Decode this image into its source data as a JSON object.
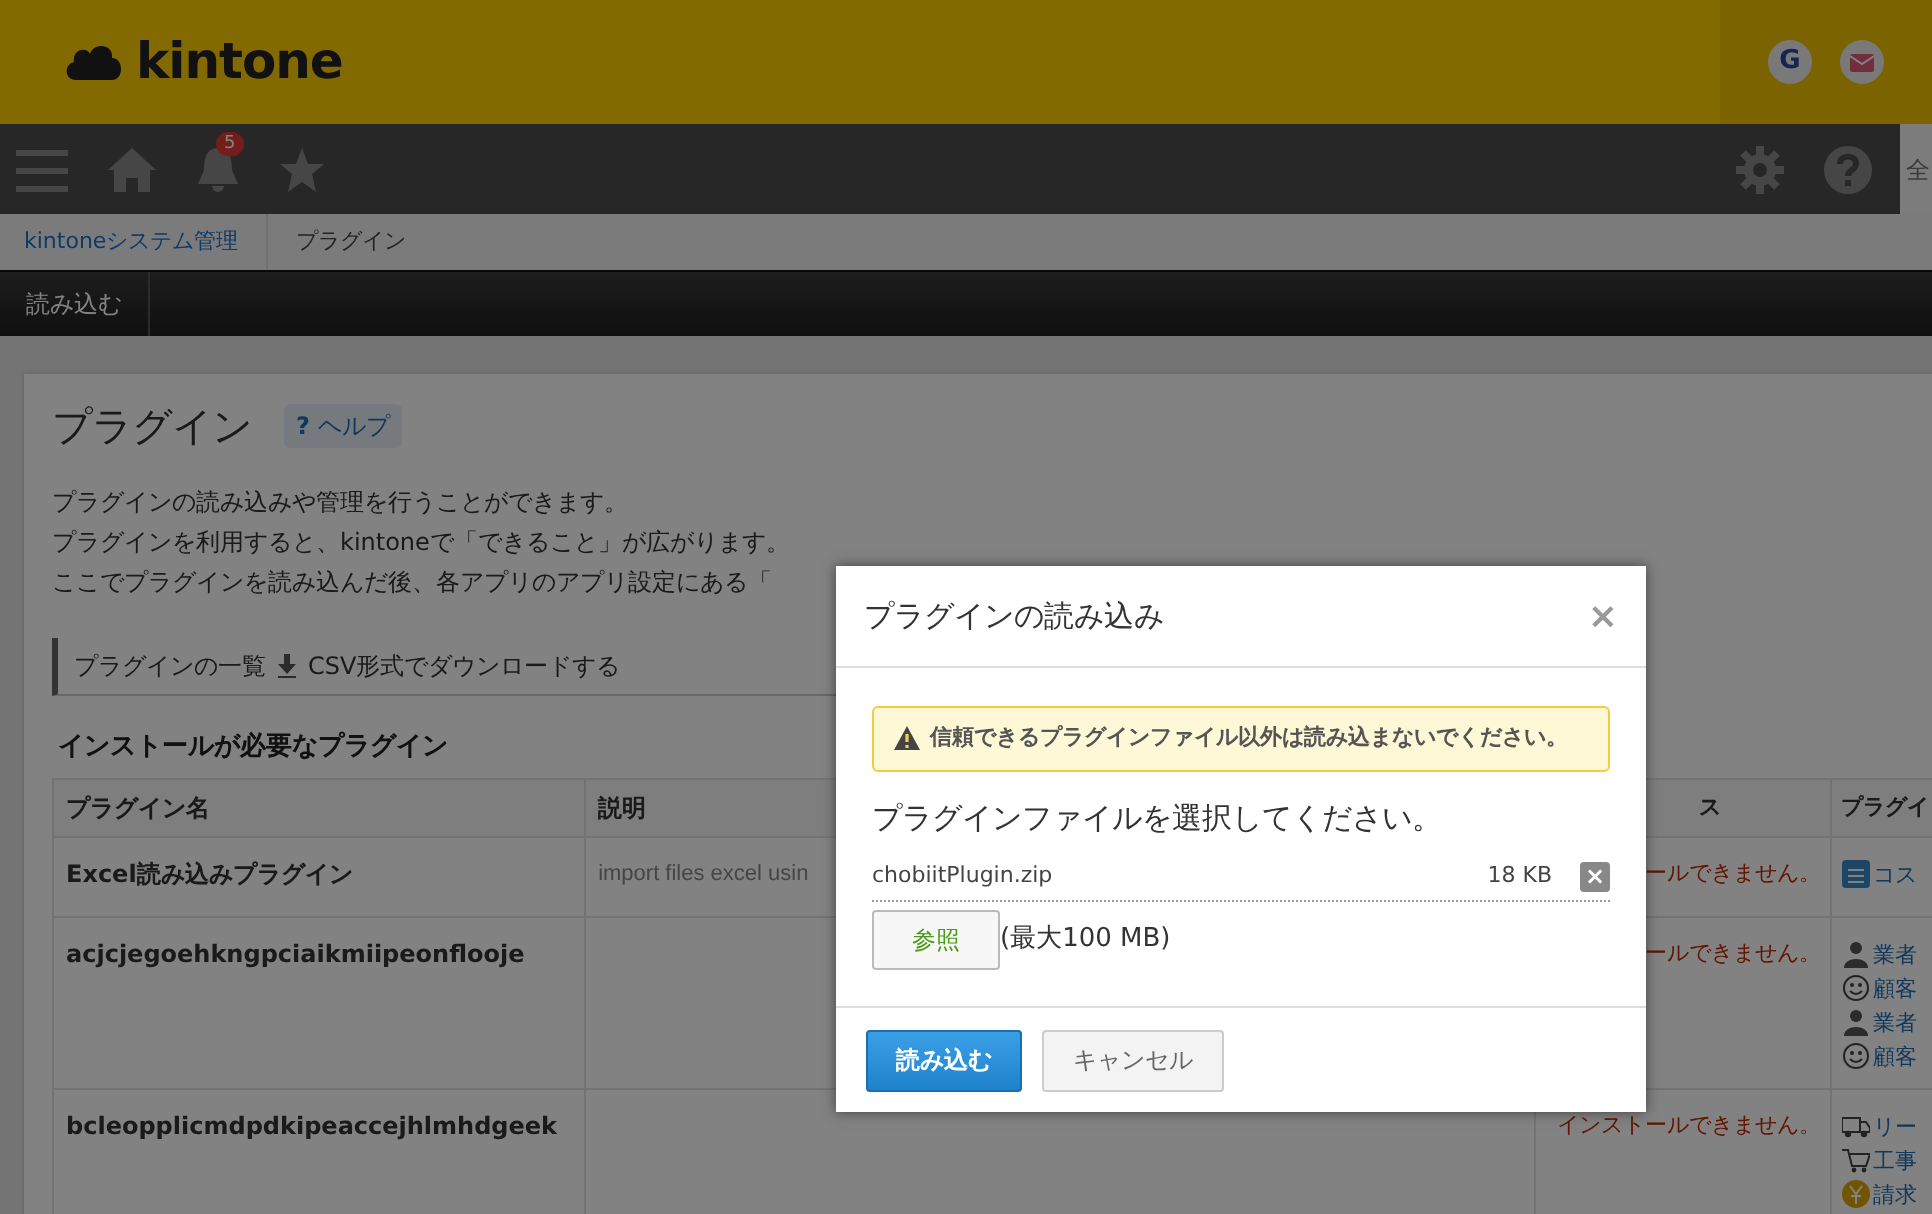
{
  "header": {
    "logo": "kintone",
    "user_initial": "G"
  },
  "nav": {
    "notification_count": "5",
    "search_placeholder": "全"
  },
  "breadcrumb": [
    {
      "label": "kintoneシステム管理",
      "link": true
    },
    {
      "label": "プラグイン",
      "link": false
    }
  ],
  "toolbar": {
    "buttons": [
      "読み込む"
    ]
  },
  "page": {
    "title": "プラグイン",
    "help_mark": "?",
    "help": "ヘルプ",
    "description": [
      "プラグインの読み込みや管理を行うことができます。",
      "プラグインを利用すると、kintoneで「できること」が広がります。",
      "ここでプラグインを読み込んだ後、各アプリのアプリ設定にある「"
    ],
    "list_heading": "プラグインの一覧",
    "csv_link": "CSV形式でダウンロードする"
  },
  "table": {
    "heading": "インストールが必要なプラグイン",
    "columns": [
      "プラグイン名",
      "説明",
      "ス",
      "プラグイ"
    ],
    "rows": [
      {
        "name": "Excel読み込みプラグイン",
        "description": "import files excel usin",
        "status": "ールできません。",
        "links": [
          {
            "kind": "list",
            "label": "コス"
          }
        ]
      },
      {
        "name": "acjcjegoehkngpciaikmiipeonflooje",
        "status": "ールできません。",
        "links": [
          {
            "kind": "worker",
            "label": "業者"
          },
          {
            "kind": "smiley",
            "label": "顧客"
          },
          {
            "kind": "worker",
            "label": "業者"
          },
          {
            "kind": "smiley",
            "label": "顧客"
          }
        ]
      },
      {
        "name": "bcleopplicmdpdkipeaccejhlmhdgeek",
        "status": "インストールできません。",
        "links": [
          {
            "kind": "truck",
            "label": "リー"
          },
          {
            "kind": "cart",
            "label": "工事"
          },
          {
            "kind": "yen",
            "label": "請求"
          }
        ]
      }
    ]
  },
  "modal": {
    "title": "プラグインの読み込み",
    "close": "×",
    "warning": "信頼できるプラグインファイル以外は読み込まないでください。",
    "prompt": "プラグインファイルを選択してください。",
    "file": {
      "name": "chobiitPlugin.zip",
      "size": "18 KB"
    },
    "browse": "参照",
    "limit": "(最大100 MB)",
    "buttons": [
      {
        "label": "読み込む",
        "kind": "primary"
      },
      {
        "label": "キャンセル",
        "kind": "secondary"
      }
    ]
  }
}
